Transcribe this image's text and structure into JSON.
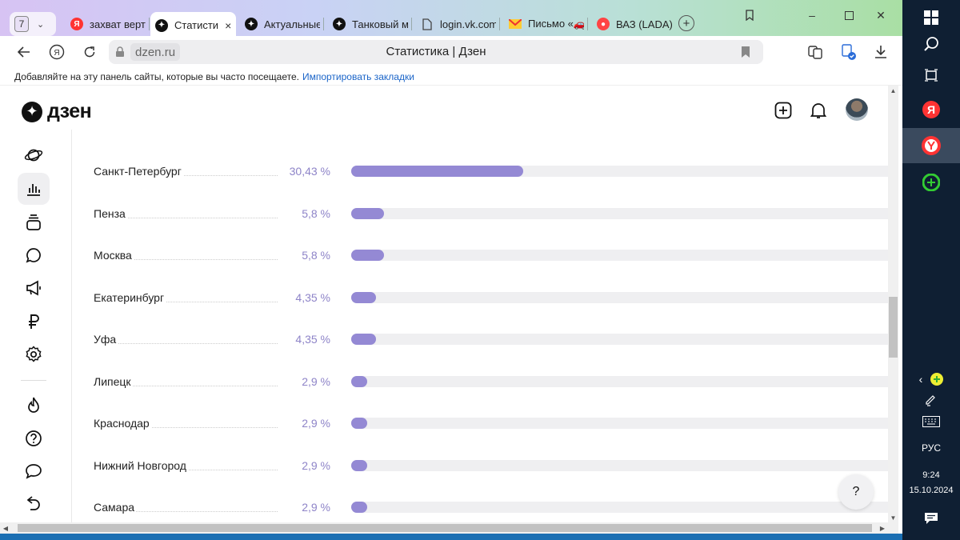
{
  "browser": {
    "tab_count": "7",
    "tabs": [
      {
        "label": "захват верт",
        "favicon": "yandex-icon",
        "color": "#f33"
      },
      {
        "label": "Статисти",
        "favicon": "dzen-icon",
        "color": "#111",
        "active": true
      },
      {
        "label": "Актуальные",
        "favicon": "dzen-icon",
        "color": "#111"
      },
      {
        "label": "Танковый м",
        "favicon": "dzen-icon",
        "color": "#111"
      },
      {
        "label": "login.vk.com",
        "favicon": "document-icon",
        "color": "#666"
      },
      {
        "label": "Письмо «🚗",
        "favicon": "mail-icon",
        "color": "#fc3"
      },
      {
        "label": "ВАЗ (LADA)",
        "favicon": "record-icon",
        "color": "#f44"
      }
    ],
    "domain": "dzen.ru",
    "page_title": "Статистика | Дзен",
    "bookmarks_prompt": "Добавляйте на эту панель сайты, которые вы часто посещаете.",
    "bookmarks_import": "Импортировать закладки"
  },
  "site": {
    "logo_text": "дзен"
  },
  "stats": {
    "rows": [
      {
        "city": "Санкт-Петербург",
        "percent_text": "30,43 %",
        "percent": 30.43
      },
      {
        "city": "Пенза",
        "percent_text": "5,8 %",
        "percent": 5.8
      },
      {
        "city": "Москва",
        "percent_text": "5,8 %",
        "percent": 5.8
      },
      {
        "city": "Екатеринбург",
        "percent_text": "4,35 %",
        "percent": 4.35
      },
      {
        "city": "Уфа",
        "percent_text": "4,35 %",
        "percent": 4.35
      },
      {
        "city": "Липецк",
        "percent_text": "2,9 %",
        "percent": 2.9
      },
      {
        "city": "Краснодар",
        "percent_text": "2,9 %",
        "percent": 2.9
      },
      {
        "city": "Нижний Новгород",
        "percent_text": "2,9 %",
        "percent": 2.9
      },
      {
        "city": "Самара",
        "percent_text": "2,9 %",
        "percent": 2.9
      }
    ],
    "bar_color": "#9489d4"
  },
  "help_label": "?",
  "taskbar": {
    "language": "РУС",
    "time": "9:24",
    "date": "15.10.2024"
  }
}
